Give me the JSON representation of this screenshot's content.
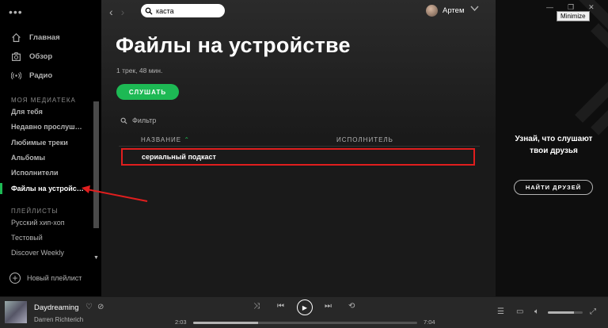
{
  "colors": {
    "accent": "#1db954",
    "highlight": "#e01e1e"
  },
  "sidebar": {
    "menu_icon": "more-dots-icon",
    "nav": [
      {
        "label": "Главная",
        "icon": "home-icon"
      },
      {
        "label": "Обзор",
        "icon": "browse-icon"
      },
      {
        "label": "Радио",
        "icon": "radio-icon"
      }
    ],
    "library_title": "МОЯ МЕДИАТЕКА",
    "library": [
      "Для тебя",
      "Недавно прослуша...",
      "Любимые треки",
      "Альбомы",
      "Исполнители",
      "Файлы на устройст..."
    ],
    "playlists_title": "ПЛЕЙЛИСТЫ",
    "playlists": [
      "Русский хип-хоп",
      "Тестовый",
      "Discover Weekly"
    ],
    "new_playlist": "Новый плейлист"
  },
  "header": {
    "search_value": "каста",
    "user_name": "Артем"
  },
  "main": {
    "title": "Файлы на устройстве",
    "meta": "1 трек, 48 мин.",
    "play_label": "СЛУШАТЬ",
    "filter_placeholder": "Фильтр",
    "col_title": "НАЗВАНИЕ",
    "col_artist": "ИСПОЛНИТЕЛЬ",
    "tracks": [
      {
        "title": "сериальный подкаст",
        "artist": ""
      }
    ]
  },
  "right_panel": {
    "tooltip": "Minimize",
    "text": "Узнай, что слушают твои друзья",
    "find_button": "НАЙТИ ДРУЗЕЙ"
  },
  "player": {
    "song": "Daydreaming",
    "artist": "Darren Richterich",
    "elapsed": "2:03",
    "duration": "7:04",
    "progress": 0.29,
    "volume": 0.75
  }
}
